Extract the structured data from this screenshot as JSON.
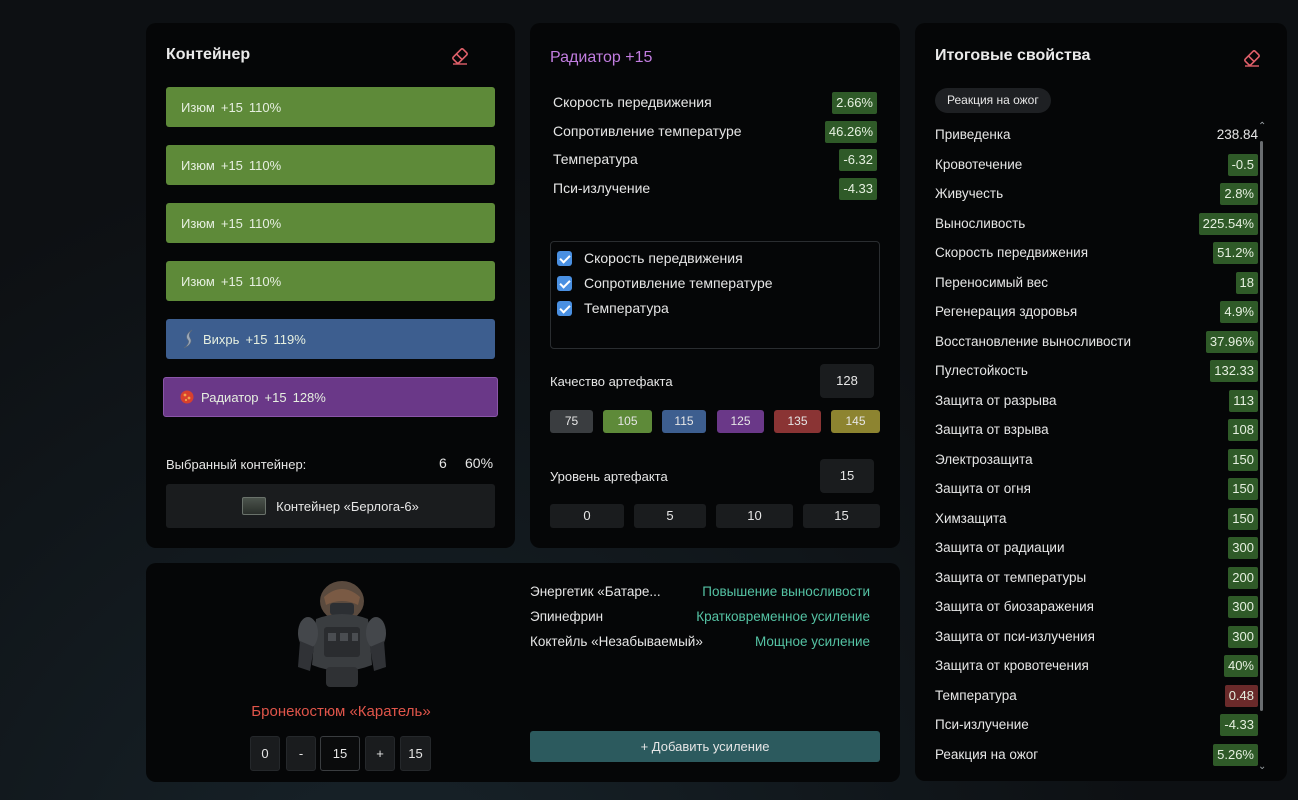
{
  "container_panel": {
    "title": "Контейнер",
    "slots": [
      {
        "name": "Изюм",
        "level": "+15",
        "percent": "110%",
        "color": "green"
      },
      {
        "name": "Изюм",
        "level": "+15",
        "percent": "110%",
        "color": "green"
      },
      {
        "name": "Изюм",
        "level": "+15",
        "percent": "110%",
        "color": "green"
      },
      {
        "name": "Изюм",
        "level": "+15",
        "percent": "110%",
        "color": "green"
      },
      {
        "name": "Вихрь",
        "level": "+15",
        "percent": "119%",
        "color": "blue"
      },
      {
        "name": "Радиатор",
        "level": "+15",
        "percent": "128%",
        "color": "purple"
      }
    ],
    "selected_label": "Выбранный контейнер:",
    "selected_slots": "6",
    "selected_percent": "60%",
    "container_button": "Контейнер «Берлога-6»"
  },
  "artifact_panel": {
    "title": "Радиатор +15",
    "stats": [
      {
        "name": "Скорость передвижения",
        "value": "2.66%"
      },
      {
        "name": "Сопротивление температуре",
        "value": "46.26%"
      },
      {
        "name": "Температура",
        "value": "-6.32"
      },
      {
        "name": "Пси-излучение",
        "value": "-4.33"
      }
    ],
    "checks": [
      {
        "label": "Скорость передвижения",
        "checked": true
      },
      {
        "label": "Сопротивление температуре",
        "checked": true
      },
      {
        "label": "Температура",
        "checked": true
      }
    ],
    "quality_label": "Качество артефакта",
    "quality_value": "128",
    "quality_presets": [
      {
        "value": "75",
        "color": "#3a3d40"
      },
      {
        "value": "105",
        "color": "#5e8a39"
      },
      {
        "value": "115",
        "color": "#3d5e8f"
      },
      {
        "value": "125",
        "color": "#6a3888"
      },
      {
        "value": "135",
        "color": "#8a3434"
      },
      {
        "value": "145",
        "color": "#8d8430"
      }
    ],
    "level_label": "Уровень артефакта",
    "level_value": "15",
    "level_presets": [
      "0",
      "5",
      "10",
      "15"
    ]
  },
  "result_panel": {
    "title": "Итоговые свойства",
    "tag": "Реакция на ожог",
    "rows": [
      {
        "name": "Приведенка",
        "value": "238.84",
        "style": "plain"
      },
      {
        "name": "Кровотечение",
        "value": "-0.5",
        "style": "green"
      },
      {
        "name": "Живучесть",
        "value": "2.8%",
        "style": "green"
      },
      {
        "name": "Выносливость",
        "value": "225.54%",
        "style": "green"
      },
      {
        "name": "Скорость передвижения",
        "value": "51.2%",
        "style": "green"
      },
      {
        "name": "Переносимый вес",
        "value": "18",
        "style": "green"
      },
      {
        "name": "Регенерация здоровья",
        "value": "4.9%",
        "style": "green"
      },
      {
        "name": "Восстановление выносливости",
        "value": "37.96%",
        "style": "green"
      },
      {
        "name": "Пулестойкость",
        "value": "132.33",
        "style": "green"
      },
      {
        "name": "Защита от разрыва",
        "value": "113",
        "style": "green"
      },
      {
        "name": "Защита от взрыва",
        "value": "108",
        "style": "green"
      },
      {
        "name": "Электрозащита",
        "value": "150",
        "style": "green"
      },
      {
        "name": "Защита от огня",
        "value": "150",
        "style": "green"
      },
      {
        "name": "Химзащита",
        "value": "150",
        "style": "green"
      },
      {
        "name": "Защита от радиации",
        "value": "300",
        "style": "green"
      },
      {
        "name": "Защита от температуры",
        "value": "200",
        "style": "green"
      },
      {
        "name": "Защита от биозаражения",
        "value": "300",
        "style": "green"
      },
      {
        "name": "Защита от пси-излучения",
        "value": "300",
        "style": "green"
      },
      {
        "name": "Защита от кровотечения",
        "value": "40%",
        "style": "green"
      },
      {
        "name": "Температура",
        "value": "0.48",
        "style": "red"
      },
      {
        "name": "Пси-излучение",
        "value": "-4.33",
        "style": "green"
      },
      {
        "name": "Реакция на ожог",
        "value": "5.26%",
        "style": "green"
      }
    ]
  },
  "armor_panel": {
    "armor_name": "Бронекостюм «Каратель»",
    "controls": {
      "min": "0",
      "minus": "-",
      "value": "15",
      "plus": "+",
      "max": "15"
    },
    "boosts": [
      {
        "name": "Энергетик «Батаре...",
        "effect": "Повышение выносливости"
      },
      {
        "name": "Эпинефрин",
        "effect": "Кратковременное усиление"
      },
      {
        "name": "Коктейль «Незабываемый»",
        "effect": "Мощное усиление"
      }
    ],
    "add_button": "+ Добавить усиление"
  },
  "colors": {
    "green_badge": "#2f5a28",
    "red_badge": "#6a2a2a",
    "accent_purple": "#c27de0",
    "armor_red": "#e0554a",
    "boost_teal": "#55c3a4"
  }
}
